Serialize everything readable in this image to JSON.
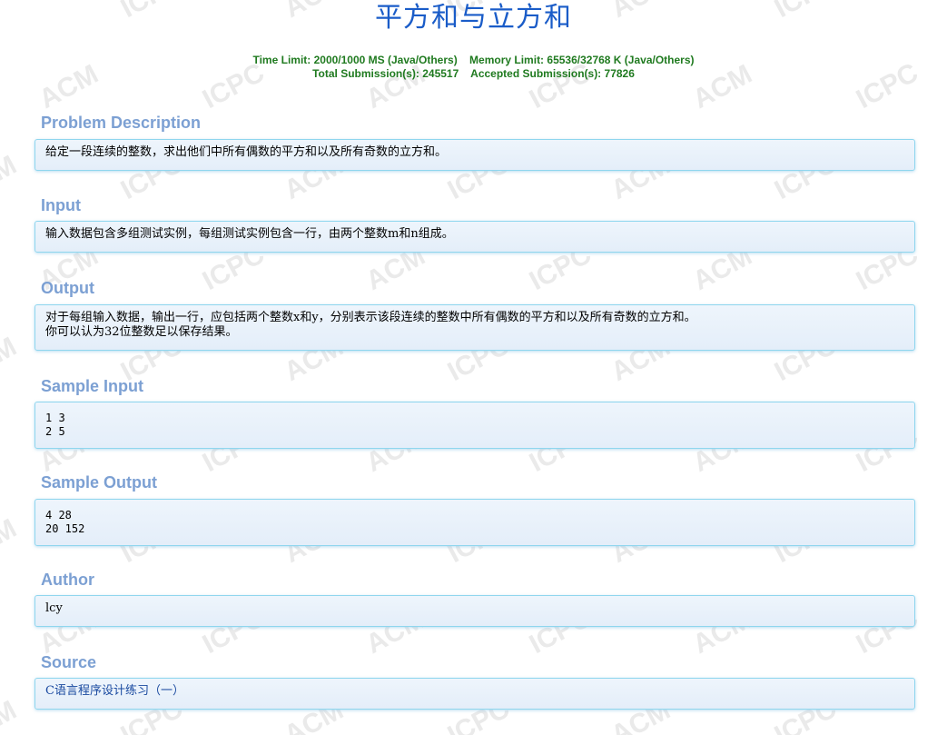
{
  "title": "平方和与立方和",
  "limits": {
    "time_limit": "Time Limit: 2000/1000 MS (Java/Others)",
    "memory_limit": "Memory Limit: 65536/32768 K (Java/Others)",
    "total_submissions": "Total Submission(s): 245517",
    "accepted_submissions": "Accepted Submission(s): 77826"
  },
  "sections": {
    "problem_description": {
      "title": "Problem Description",
      "content": "给定一段连续的整数，求出他们中所有偶数的平方和以及所有奇数的立方和。"
    },
    "input": {
      "title": "Input",
      "content": "输入数据包含多组测试实例，每组测试实例包含一行，由两个整数m和n组成。"
    },
    "output": {
      "title": "Output",
      "lines": [
        "对于每组输入数据，输出一行，应包括两个整数x和y，分别表示该段连续的整数中所有偶数的平方和以及所有奇数的立方和。",
        "你可以认为32位整数足以保存结果。"
      ]
    },
    "sample_input": {
      "title": "Sample Input",
      "lines": [
        "1 3",
        "2 5"
      ]
    },
    "sample_output": {
      "title": "Sample Output",
      "lines": [
        "4 28",
        "20 152"
      ]
    },
    "author": {
      "title": "Author",
      "content": "lcy"
    },
    "source": {
      "title": "Source",
      "link_text": "C语言程序设计练习（一）"
    }
  },
  "colors": {
    "title": "#1a5cc8",
    "limits": "#1f7a1f",
    "section_title": "#7ca0d3",
    "panel_border": "#8fd6ee",
    "panel_bg": "#e8f1fb",
    "link": "#1a4aa0"
  },
  "watermark_texts": [
    "ACM",
    "ICPC"
  ]
}
